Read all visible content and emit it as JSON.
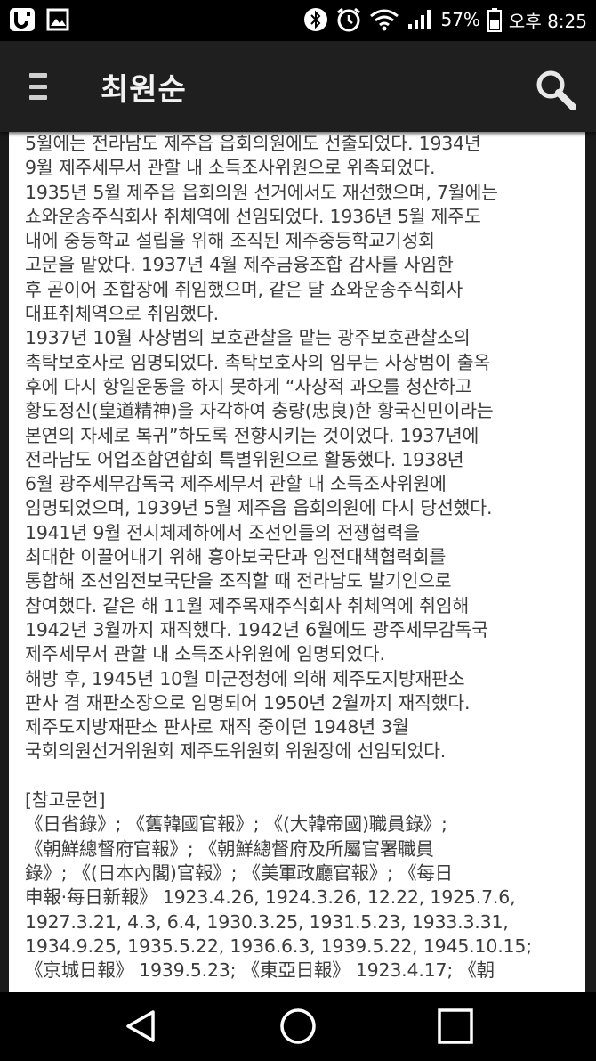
{
  "status_bar": {
    "time": "오후 8:25",
    "battery": "57%",
    "icons": [
      "u-plus-icon",
      "image-icon",
      "bluetooth-icon",
      "alarm-icon",
      "wifi-icon",
      "signal-icon",
      "battery-icon"
    ]
  },
  "app_bar": {
    "title": "최원순",
    "menu_icon": "menu-icon",
    "search_icon": "search-icon"
  },
  "article": {
    "text": "5월에는 전라남도 제주읍 읍회의원에도 선출되었다. 1934년\n9월 제주세무서 관할 내 소득조사위원으로 위촉되었다.\n1935년 5월 제주읍 읍회의원 선거에서도 재선했으며, 7월에는\n쇼와운송주식회사 취체역에 선임되었다. 1936년 5월 제주도\n내에 중등학교 설립을 위해 조직된 제주중등학교기성회\n고문을 맡았다. 1937년 4월 제주금융조합 감사를 사임한\n후 곧이어 조합장에 취임했으며, 같은 달 쇼와운송주식회사\n대표취체역으로 취임했다.\n1937년 10월 사상범의 보호관찰을 맡는 광주보호관찰소의\n촉탁보호사로 임명되었다. 촉탁보호사의 임무는 사상범이 출옥\n후에 다시 항일운동을 하지 못하게 “사상적 과오를 청산하고\n황도정신(皇道精神)을 자각하여 충량(忠良)한 황국신민이라는\n본연의 자세로 복귀”하도록 전향시키는 것이었다. 1937년에\n전라남도 어업조합연합회 특별위원으로 활동했다. 1938년\n6월 광주세무감독국 제주세무서 관할 내 소득조사위원에\n임명되었으며, 1939년 5월 제주읍 읍회의원에 다시 당선했다.\n1941년 9월 전시체제하에서 조선인들의 전쟁협력을\n최대한 이끌어내기 위해 흥아보국단과 임전대책협력회를\n통합해 조선임전보국단을 조직할 때 전라남도 발기인으로\n참여했다. 같은 해 11월 제주목재주식회사 취체역에 취임해\n1942년 3월까지 재직했다. 1942년 6월에도 광주세무감독국\n제주세무서 관할 내 소득조사위원에 임명되었다.\n해방 후, 1945년 10월 미군정청에 의해 제주도지방재판소\n판사 겸 재판소장으로 임명되어 1950년 2월까지 재직했다.\n제주도지방재판소 판사로 재직 중이던 1948년 3월\n국회의원선거위원회 제주도위원회 위원장에 선임되었다.\n\n[참고문헌]\n《日省錄》; 《舊韓國官報》; 《(大韓帝國)職員錄》;\n《朝鮮總督府官報》; 《朝鮮總督府及所屬官署職員\n錄》; 《(日本內閣)官報》; 《美軍政廳官報》; 《每日\n申報·每日新報》 1923.4.26, 1924.3.26, 12.22, 1925.7.6,\n1927.3.21, 4.3, 6.4, 1930.3.25, 1931.5.23, 1933.3.31,\n1934.9.25, 1935.5.22, 1936.6.3, 1939.5.22, 1945.10.15;\n《京城日報》 1939.5.23; 《東亞日報》 1923.4.17; 《朝"
  },
  "nav_bar": {
    "icons": [
      "back-icon",
      "home-icon",
      "recent-apps-icon"
    ]
  },
  "colors": {
    "status_bar_bg": "#000000",
    "app_bar_bg": "#1f1f1f",
    "content_bg": "#ffffff",
    "text": "#3c3c3c"
  }
}
